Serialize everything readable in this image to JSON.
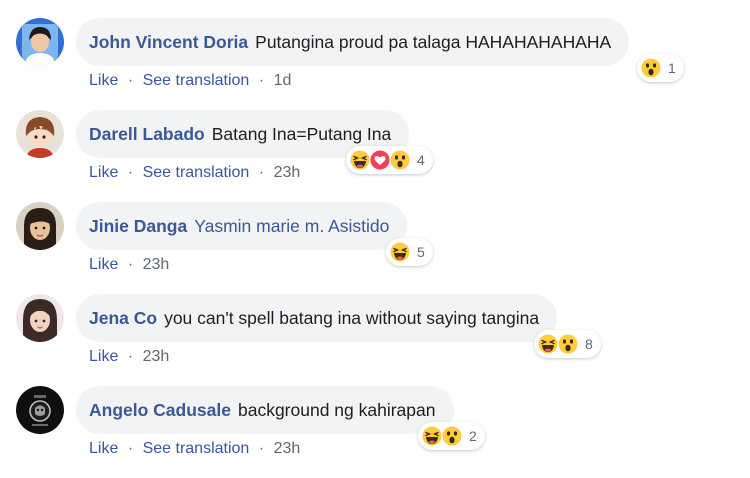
{
  "colors": {
    "author": "#385898",
    "bubble": "#f2f3f5",
    "meta": "#606770"
  },
  "comments": [
    {
      "author": "John Vincent Doria",
      "text": "Putangina proud pa talaga HAHAHAHAHAHA",
      "like": "Like",
      "translate": "See translation",
      "sep": "·",
      "time": "1d",
      "reactions": [
        "wow"
      ],
      "reaction_count": "1",
      "avatar_icon": "male-avatar-icon"
    },
    {
      "author": "Darell Labado",
      "text": "Batang Ina=Putang Ina",
      "like": "Like",
      "translate": "See translation",
      "sep": "·",
      "time": "23h",
      "reactions": [
        "haha",
        "love",
        "wow"
      ],
      "reaction_count": "4",
      "avatar_icon": "anime-avatar-icon"
    },
    {
      "author": "Jinie Danga",
      "text": "Yasmin marie m. Asistido",
      "like": "Like",
      "sep": "·",
      "time": "23h",
      "reactions": [
        "haha"
      ],
      "reaction_count": "5",
      "avatar_icon": "female-avatar-icon"
    },
    {
      "author": "Jena Co",
      "text": "you can't spell batang ina without saying tangina",
      "like": "Like",
      "sep": "·",
      "time": "23h",
      "reactions": [
        "haha",
        "wow"
      ],
      "reaction_count": "8",
      "avatar_icon": "female-avatar-icon"
    },
    {
      "author": "Angelo Cadusale",
      "text": "background ng kahirapan",
      "like": "Like",
      "translate": "See translation",
      "sep": "·",
      "time": "23h",
      "reactions": [
        "haha",
        "wow"
      ],
      "reaction_count": "2",
      "avatar_icon": "dark-logo-avatar-icon"
    }
  ]
}
